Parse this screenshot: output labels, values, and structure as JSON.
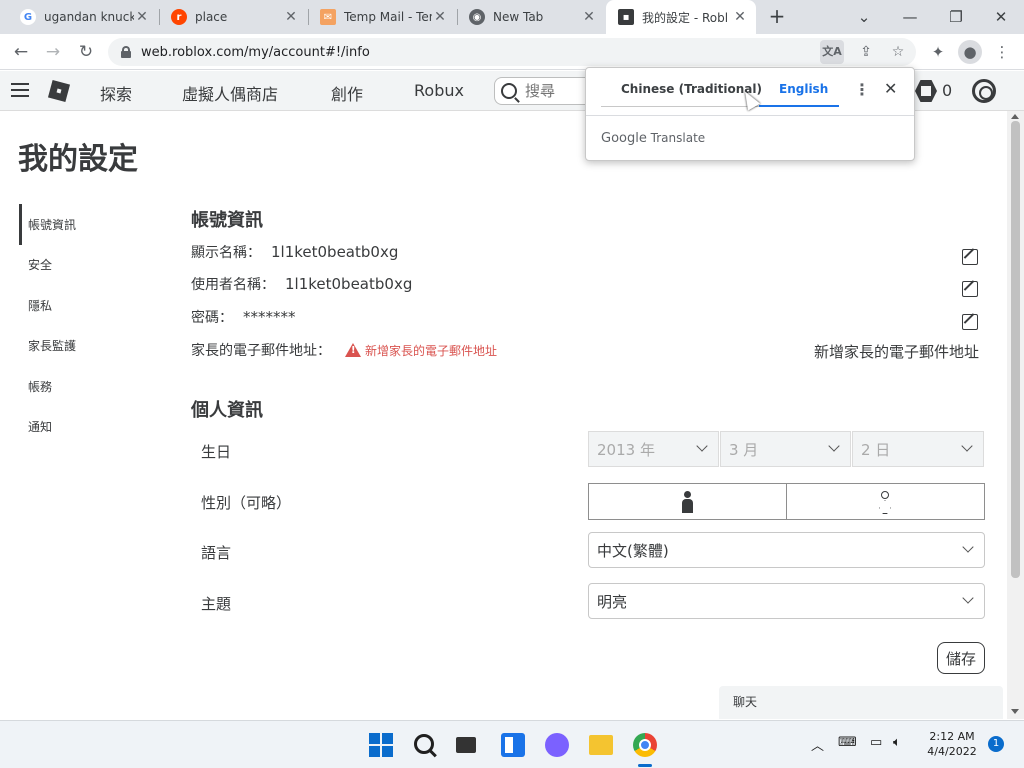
{
  "browser": {
    "tabs": [
      {
        "label": "ugandan knuckl",
        "favicon": "G",
        "color": "#4285f4"
      },
      {
        "label": "place",
        "favicon": "r",
        "color": "#ff4500"
      },
      {
        "label": "Temp Mail - Ten",
        "favicon": "✉",
        "color": "#f4a261"
      },
      {
        "label": "New Tab",
        "favicon": "◉",
        "color": "#5f6368"
      },
      {
        "label": "我的設定 - Robl",
        "favicon": "▪",
        "color": "#393b3d"
      }
    ],
    "new_tab": "+",
    "url": "web.roblox.com/my/account#!/info"
  },
  "nav": {
    "links": [
      "探索",
      "虛擬人偶商店",
      "創作",
      "Robux"
    ],
    "search_placeholder": "搜尋",
    "robux_count": "0"
  },
  "translate_popup": {
    "tab_source": "Chinese (Traditional)",
    "tab_target": "English",
    "brand": "Google",
    "brand_suffix": "Translate",
    "more": "⋮",
    "close": "✕"
  },
  "page": {
    "title": "我的設定",
    "menu": [
      "帳號資訊",
      "安全",
      "隱私",
      "家長監護",
      "帳務",
      "通知"
    ],
    "account_section": "帳號資訊",
    "display_name_label": "顯示名稱：",
    "display_name_value": "1l1ket0beatb0xg",
    "username_label": "使用者名稱：",
    "username_value": "1l1ket0beatb0xg",
    "password_label": "密碼：",
    "password_value": "*******",
    "parent_email_label": "家長的電子郵件地址：",
    "parent_email_warning": "新增家長的電子郵件地址",
    "add_parent_email": "新增家長的電子郵件地址",
    "personal_section": "個人資訊",
    "birthday_label": "生日",
    "birth_year": "2013 年",
    "birth_month": "3 月",
    "birth_day": "2 日",
    "gender_label": "性別（可略）",
    "language_label": "語言",
    "language_value": "中文(繁體)",
    "theme_label": "主題",
    "theme_value": "明亮",
    "save": "儲存",
    "chat": "聊天"
  },
  "taskbar": {
    "time": "2:12 AM",
    "date": "4/4/2022",
    "notifications": "1"
  }
}
